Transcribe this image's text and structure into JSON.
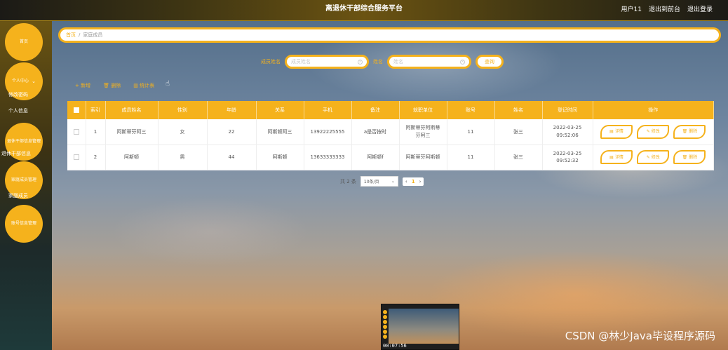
{
  "app": {
    "title": "离退休干部综合服务平台"
  },
  "top_links": {
    "user": "用户11",
    "to_front": "退出到前台",
    "logout": "退出登录"
  },
  "sidebar": {
    "home": "首页",
    "personal_center": "个人中心",
    "personal_sub": [
      "修改密码",
      "个人信息"
    ],
    "retiree_mgmt": "退休干部信息管理",
    "retiree_sub": "退休干部信息",
    "family_mgmt": "家庭成员管理",
    "family_sub": "家庭成员",
    "account_mgmt": "账号信息管理"
  },
  "breadcrumb": {
    "home": "首页",
    "current": "家庭成员"
  },
  "search": {
    "member_label": "成员姓名",
    "member_placeholder": "成员姓名",
    "name_label": "姓名",
    "name_placeholder": "姓名",
    "button": "查询"
  },
  "actions": {
    "add": "+ 新增",
    "delete": "删除",
    "stats": "统计表"
  },
  "table": {
    "headers": [
      "索引",
      "成员姓名",
      "性别",
      "年龄",
      "关系",
      "手机",
      "备注",
      "就职单位",
      "账号",
      "姓名",
      "登记时间",
      "操作"
    ],
    "rows": [
      [
        "1",
        "阿斯蒂芬阿三",
        "女",
        "22",
        "阿斯顿阿三",
        "13922225555",
        "a是否按时",
        "阿斯蒂芬阿斯蒂芬阿三",
        "11",
        "张三",
        "2022-03-25 09:52:06"
      ],
      [
        "2",
        "阿斯顿",
        "男",
        "44",
        "阿斯顿",
        "13633333333",
        "阿斯顿f",
        "阿斯蒂芬阿斯顿",
        "11",
        "张三",
        "2022-03-25 09:52:32"
      ]
    ],
    "op_labels": {
      "detail": "详情",
      "edit": "修改",
      "delete": "删除"
    }
  },
  "pager": {
    "total": "共 2 条",
    "page_size": "10条/页",
    "current": "1"
  },
  "thumbnail": {
    "time": "00:07:56"
  },
  "watermark": "CSDN @林少Java毕设程序源码",
  "colors": {
    "accent": "#f5b21c"
  }
}
